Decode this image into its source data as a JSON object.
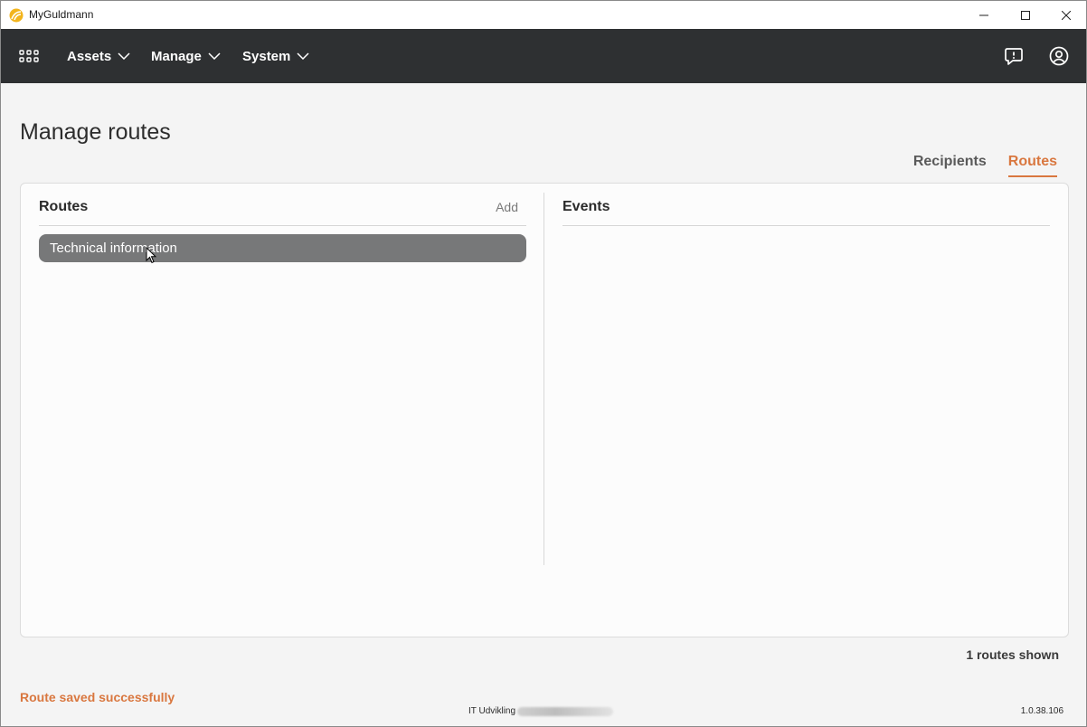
{
  "window": {
    "title": "MyGuldmann",
    "minimize_icon": "minimize-icon",
    "maximize_icon": "maximize-icon",
    "close_icon": "close-icon"
  },
  "nav": {
    "apps_icon": "apps-grid-icon",
    "menus": [
      {
        "label": "Assets"
      },
      {
        "label": "Manage"
      },
      {
        "label": "System"
      }
    ],
    "feedback_icon": "feedback-icon",
    "user_icon": "user-account-icon"
  },
  "page": {
    "title": "Manage routes",
    "tabs": [
      {
        "label": "Recipients",
        "active": false
      },
      {
        "label": "Routes",
        "active": true
      }
    ]
  },
  "routes_panel": {
    "title": "Routes",
    "add_label": "Add",
    "items": [
      {
        "label": "Technical information",
        "selected": true
      }
    ]
  },
  "events_panel": {
    "title": "Events"
  },
  "footer": {
    "routes_count": "1 routes shown",
    "status_message": "Route saved successfully",
    "environment": "IT Udvikling",
    "version": "1.0.38.106"
  },
  "colors": {
    "accent": "#d9773f",
    "navbar": "#2e3032",
    "selected_item": "#777879"
  }
}
